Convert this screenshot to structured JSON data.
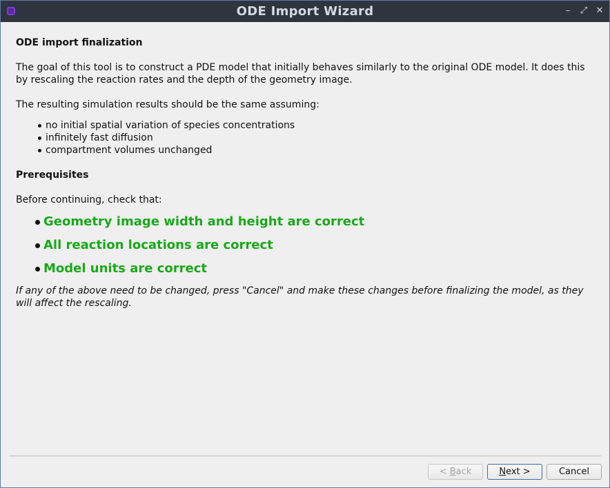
{
  "window": {
    "title": "ODE Import Wizard",
    "controls": {
      "minimize": "–",
      "maximize": "⤢",
      "close": "✕"
    }
  },
  "content": {
    "heading": "ODE import finalization",
    "intro": "The goal of this tool is to construct a PDE model that initially behaves similarly to the original ODE model. It does this by rescaling the reaction rates and the depth of the geometry image.",
    "assumption_lead": "The resulting simulation results should be the same assuming:",
    "assumptions": [
      "no initial spatial variation of species concentrations",
      "infinitely fast diffusion",
      "compartment volumes unchanged"
    ],
    "prereq_heading": "Prerequisites",
    "prereq_lead": "Before continuing, check that:",
    "checks": [
      "Geometry image width and height are correct",
      "All reaction locations are correct",
      "Model units are correct"
    ],
    "note": "If any of the above need to be changed, press \"Cancel\" and make these changes before finalizing the model, as they will affect the rescaling."
  },
  "buttons": {
    "back": {
      "prefix": "< ",
      "mnemonic": "B",
      "rest": "ack"
    },
    "next": {
      "mnemonic": "N",
      "rest": "ext >"
    },
    "cancel": "Cancel"
  },
  "colors": {
    "titlebar": "#2f343f",
    "check_text": "#1aa81a",
    "background": "#efefef"
  }
}
